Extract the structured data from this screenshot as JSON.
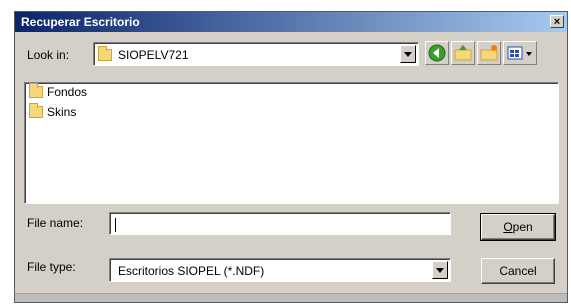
{
  "window": {
    "title": "Recuperar Escritorio",
    "close_label": "×"
  },
  "lookin": {
    "label": "Look in:",
    "value": "SIOPELV721"
  },
  "toolbar": {
    "back": "back-icon",
    "up": "up-folder-icon",
    "new_folder": "new-folder-icon",
    "view": "view-menu-icon"
  },
  "files": [
    {
      "name": "Fondos"
    },
    {
      "name": "Skins"
    }
  ],
  "filename": {
    "label": "File name:",
    "value": ""
  },
  "filetype": {
    "label": "File type:",
    "value": "Escritorios SIOPEL (*.NDF)"
  },
  "buttons": {
    "open_mnemonic": "O",
    "open_rest": "pen",
    "cancel": "Cancel"
  },
  "colors": {
    "title_start": "#0a246a",
    "title_end": "#a6caf0",
    "face": "#d4d0c8"
  }
}
